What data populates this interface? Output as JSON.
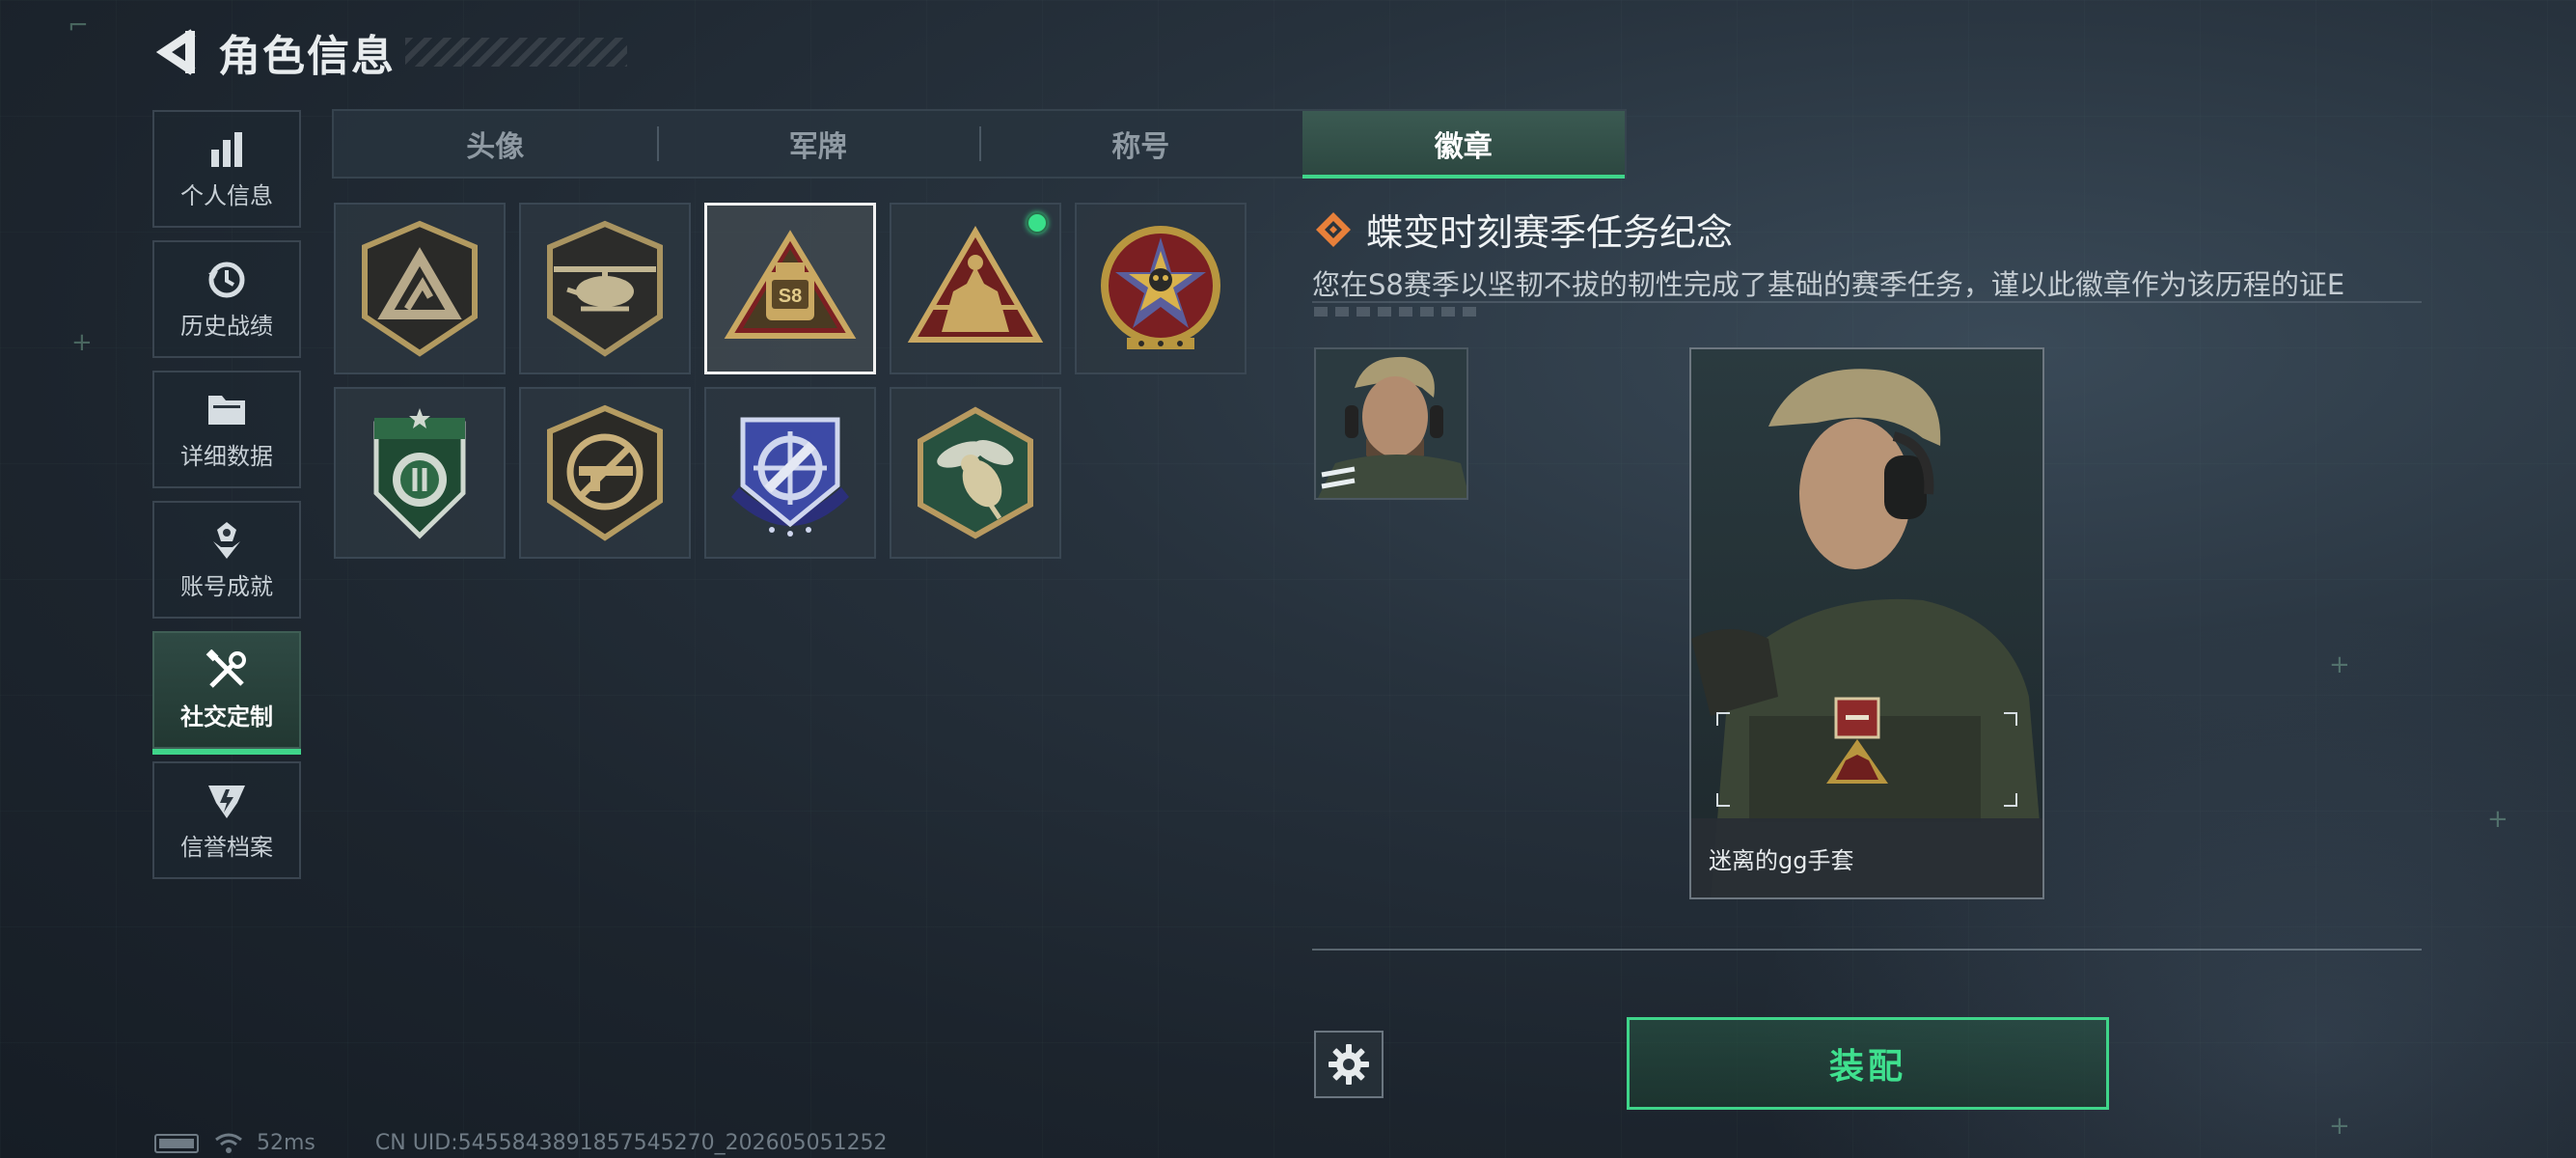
{
  "header": {
    "title": "角色信息"
  },
  "sidenav": {
    "items": [
      {
        "label": "个人信息",
        "icon": "bar-chart-icon",
        "active": false
      },
      {
        "label": "历史战绩",
        "icon": "history-icon",
        "active": false
      },
      {
        "label": "详细数据",
        "icon": "folder-icon",
        "active": false
      },
      {
        "label": "账号成就",
        "icon": "achievement-icon",
        "active": false
      },
      {
        "label": "社交定制",
        "icon": "wrench-screwdriver-icon",
        "active": true
      },
      {
        "label": "信誉档案",
        "icon": "credit-icon",
        "active": false
      }
    ]
  },
  "tabs": [
    {
      "label": "头像",
      "active": false
    },
    {
      "label": "军牌",
      "active": false
    },
    {
      "label": "称号",
      "active": false
    },
    {
      "label": "徽章",
      "active": true
    }
  ],
  "badges": [
    {
      "icon": "triangle-emblem-badge",
      "selected": false,
      "equipped": false
    },
    {
      "icon": "helicopter-badge",
      "selected": false,
      "equipped": false
    },
    {
      "icon": "s8-season-badge",
      "text": "S8",
      "selected": true,
      "equipped": false
    },
    {
      "icon": "squad-triangle-badge",
      "selected": false,
      "equipped": true
    },
    {
      "icon": "skull-star-badge",
      "selected": false,
      "equipped": false
    },
    {
      "icon": "green-shield-badge",
      "selected": false,
      "equipped": false
    },
    {
      "icon": "no-rifle-badge",
      "selected": false,
      "equipped": false
    },
    {
      "icon": "sniper-target-badge",
      "selected": false,
      "equipped": false
    },
    {
      "icon": "hornet-hexagon-badge",
      "selected": false,
      "equipped": false
    }
  ],
  "detail": {
    "title": "蝶变时刻赛季任务纪念",
    "description": "您在S8赛季以坚韧不拔的韧性完成了基础的赛季任务，谨以此徽章作为该历程的证E"
  },
  "preview": {
    "caption": "迷离的gg手套"
  },
  "actions": {
    "equip_label": "装配",
    "settings_icon": "gear-icon"
  },
  "status": {
    "ping": "52ms",
    "uid": "CN UID:5455843891857545270_202605051252"
  },
  "colors": {
    "accent": "#3fd58a",
    "badge_gold": "#c9a862",
    "detail_diamond": "#e8803a"
  }
}
